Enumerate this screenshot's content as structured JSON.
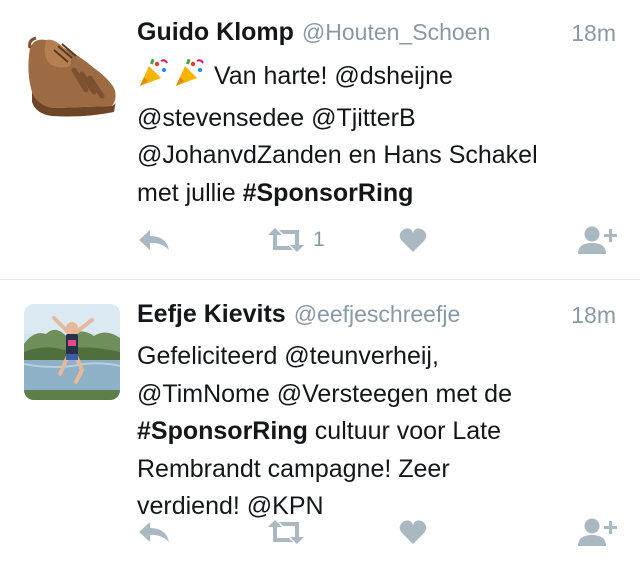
{
  "tweets": [
    {
      "name": "Guido Klomp",
      "handle": "@Houten_Schoen",
      "time": "18m",
      "avatar": "brown-leather-shoe",
      "lines": [
        {
          "emoji": true,
          "text": " Van harte! @dsheijne"
        },
        {
          "text": "@stevensedee @TjitterB"
        },
        {
          "text": "@JohanvdZanden en Hans Schakel"
        },
        {
          "text": "met jullie ",
          "hashtag": "#SponsorRing"
        }
      ],
      "retweet_count": "1"
    },
    {
      "name": "Eefje Kievits",
      "handle": "@eefjeschreefje",
      "time": "18m",
      "avatar": "person-jumping-by-lake",
      "lines": [
        {
          "text": "Gefeliciteerd @teunverheij,"
        },
        {
          "text": "@TimNome @Versteegen met de"
        },
        {
          "hashtag": "#SponsorRing",
          "text": " cultuur voor Late"
        },
        {
          "text": "Rembrandt campagne! Zeer"
        },
        {
          "text": "verdiend! @KPN"
        }
      ],
      "retweet_count": ""
    }
  ],
  "icons": {
    "reply": "reply-icon",
    "retweet": "retweet-icon",
    "like": "heart-icon",
    "follow": "follow-user-icon",
    "celebrate": "party-popper-icon"
  },
  "colors": {
    "name": "#14171a",
    "meta": "#8899a6",
    "icon": "#aab8c2",
    "divider": "#e1e8ed"
  }
}
